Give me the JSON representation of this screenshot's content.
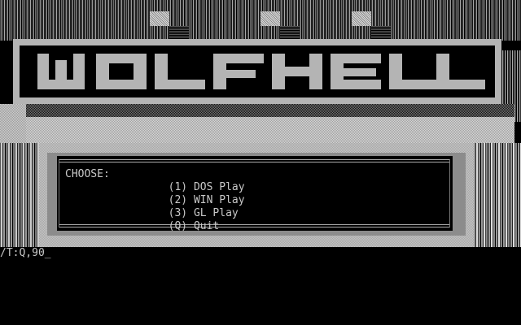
{
  "logo": {
    "text": "WOLFHELL"
  },
  "menu": {
    "prompt": "CHOOSE:",
    "options": [
      {
        "key": "(1)",
        "label": "DOS Play"
      },
      {
        "key": "(2)",
        "label": "WIN Play"
      },
      {
        "key": "(3)",
        "label": "GL Play"
      },
      {
        "key": "(Q)",
        "label": "Quit"
      }
    ]
  },
  "command_line": {
    "text": "/T:Q,90",
    "cursor": "_"
  },
  "colors": {
    "background": "#000000",
    "logo_gray": "#b4b4b4",
    "text_gray": "#c8c8c8"
  }
}
